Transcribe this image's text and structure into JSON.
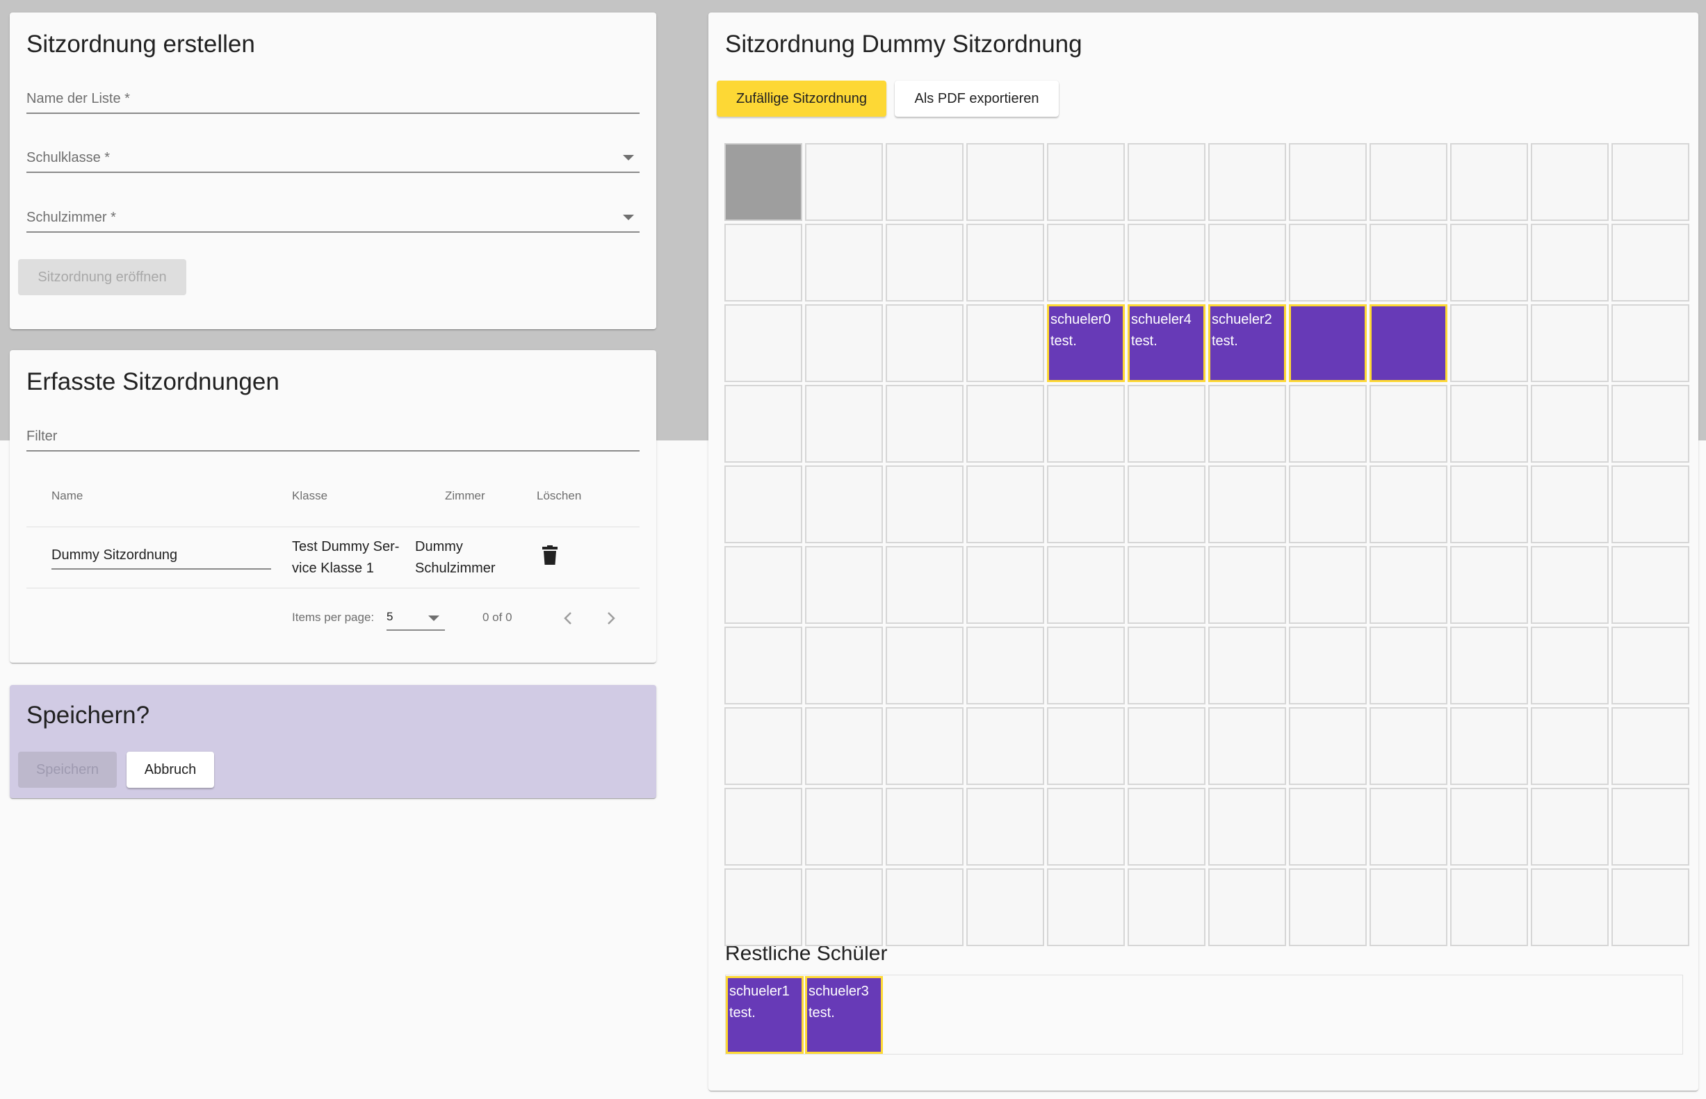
{
  "create_card": {
    "title": "Sitzordnung erstellen",
    "name_field_label": "Name der Liste *",
    "class_field_label": "Schulklasse *",
    "room_field_label": "Schulzimmer *",
    "open_button": "Sitzordnung eröffnen"
  },
  "list_card": {
    "title": "Erfasste Sitzordnungen",
    "filter_label": "Filter",
    "columns": {
      "name": "Name",
      "class": "Klasse",
      "room": "Zimmer",
      "delete": "Löschen"
    },
    "rows": [
      {
        "name": "Dummy Sitzordnung",
        "class_line1": "Test Dummy Ser-",
        "class_line2": "vice Klasse 1",
        "room_line1": "Dummy",
        "room_line2": "Schulzimmer"
      }
    ],
    "paginator": {
      "items_per_page_label": "Items per page:",
      "page_size": "5",
      "range": "0 of 0"
    }
  },
  "save_card": {
    "title": "Speichern?",
    "save_button": "Speichern",
    "cancel_button": "Abbruch"
  },
  "seating_card": {
    "title": "Sitzordnung Dummy Sitzordnung",
    "random_button": "Zufällige Sitzordnung",
    "pdf_button": "Als PDF exportieren",
    "grid": {
      "rows": 10,
      "cols": 12,
      "teacher_cell": {
        "row": 0,
        "col": 0
      }
    },
    "placed_students": [
      {
        "row": 2,
        "col": 4,
        "line1": "schueler0",
        "line2": "test."
      },
      {
        "row": 2,
        "col": 5,
        "line1": "schueler4",
        "line2": "test."
      },
      {
        "row": 2,
        "col": 6,
        "line1": "schueler2",
        "line2": "test."
      },
      {
        "row": 2,
        "col": 7,
        "line1": "",
        "line2": ""
      },
      {
        "row": 2,
        "col": 8,
        "line1": "",
        "line2": ""
      }
    ],
    "remaining_title": "Restliche Schüler",
    "remaining_students": [
      {
        "line1": "schueler1",
        "line2": "test."
      },
      {
        "line1": "schueler3",
        "line2": "test."
      }
    ]
  },
  "colors": {
    "accent_yellow": "#fdd835",
    "student_purple": "#673ab7",
    "save_card_bg": "#d1cbe4"
  },
  "icons": {
    "delete": "trash-icon",
    "caret": "dropdown-caret-icon",
    "prev": "chevron-left-icon",
    "next": "chevron-right-icon"
  }
}
